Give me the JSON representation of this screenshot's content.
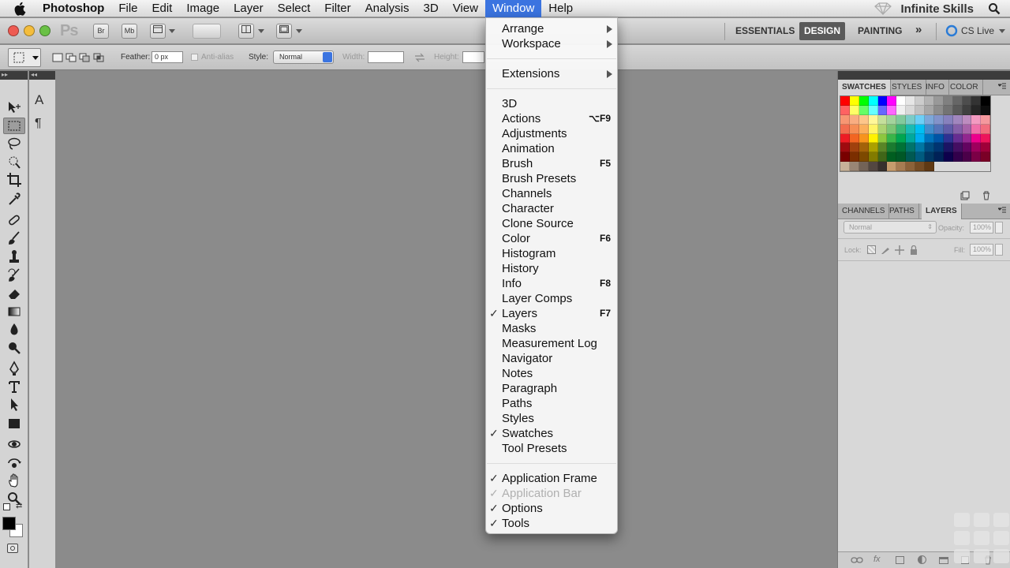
{
  "menubar": {
    "app_name": "Photoshop",
    "items": [
      "File",
      "Edit",
      "Image",
      "Layer",
      "Select",
      "Filter",
      "Analysis",
      "3D",
      "View",
      "Window",
      "Help"
    ],
    "active": "Window",
    "brand": "Infinite Skills"
  },
  "appbar": {
    "logo": "Ps",
    "bridge_btn": "Br",
    "minibridge_btn": "Mb",
    "workspaces": [
      "ESSENTIALS",
      "DESIGN",
      "PAINTING"
    ],
    "active_workspace": "DESIGN",
    "more": "»",
    "cs_live": "CS Live"
  },
  "options": {
    "feather_label": "Feather:",
    "feather_value": "0 px",
    "antialias_label": "Anti-alias",
    "style_label": "Style:",
    "style_value": "Normal",
    "width_label": "Width:",
    "height_label": "Height:"
  },
  "tools": [
    "move",
    "marquee",
    "lasso",
    "quick-select",
    "crop",
    "eyedropper",
    "healing",
    "brush",
    "stamp",
    "history-brush",
    "eraser",
    "gradient",
    "blur",
    "dodge",
    "pen",
    "type",
    "path-select",
    "shape",
    "3d-rotate",
    "3d-orbit",
    "hand",
    "zoom"
  ],
  "panels": {
    "top_tabs": [
      "SWATCHES",
      "STYLES",
      "INFO",
      "COLOR"
    ],
    "top_active": "SWATCHES",
    "bottom_tabs": [
      "CHANNELS",
      "PATHS",
      "LAYERS"
    ],
    "bottom_active": "LAYERS",
    "blend_mode": "Normal",
    "opacity_label": "Opacity:",
    "opacity_value": "100%",
    "lock_label": "Lock:",
    "fill_label": "Fill:",
    "fill_value": "100%",
    "swatches": [
      "#ff0000",
      "#ffff00",
      "#00ff00",
      "#00ffff",
      "#0000ff",
      "#ff00ff",
      "#ffffff",
      "#e6e6e6",
      "#cccccc",
      "#b3b3b3",
      "#999999",
      "#808080",
      "#666666",
      "#4d4d4d",
      "#333333",
      "#000000",
      "#ff6262",
      "#ffff66",
      "#66ff66",
      "#66ffff",
      "#6666ff",
      "#ff66ff",
      "#f0f0f0",
      "#d9d9d9",
      "#c0c0c0",
      "#a6a6a6",
      "#8c8c8c",
      "#737373",
      "#595959",
      "#404040",
      "#262626",
      "#0d0d0d",
      "#f79673",
      "#f9ad81",
      "#fdc68a",
      "#fff799",
      "#c4df9b",
      "#a3d39c",
      "#82ca9c",
      "#7accc8",
      "#6dcff6",
      "#7da7d9",
      "#8393ca",
      "#8781bd",
      "#a186be",
      "#bd8cbf",
      "#f49ac1",
      "#f5989d",
      "#f26c4f",
      "#f68e55",
      "#fbaf5c",
      "#fff467",
      "#acd373",
      "#7cc576",
      "#3bb878",
      "#1abbb4",
      "#00bff3",
      "#438ccb",
      "#5574b9",
      "#605ca8",
      "#855fa8",
      "#a763a8",
      "#f06ea9",
      "#f26d7d",
      "#ed1c24",
      "#f26522",
      "#f7941d",
      "#fff200",
      "#8dc73f",
      "#39b54a",
      "#00a651",
      "#00a99d",
      "#00aeef",
      "#0072bc",
      "#0054a6",
      "#2e3192",
      "#662d91",
      "#92278f",
      "#ec008c",
      "#ed145b",
      "#9e0b0f",
      "#a0410d",
      "#a36209",
      "#aba000",
      "#598527",
      "#1a7b30",
      "#007236",
      "#00746b",
      "#0076a3",
      "#004b80",
      "#003471",
      "#1b1464",
      "#440e62",
      "#630460",
      "#9e005d",
      "#9e0039",
      "#790000",
      "#7b2e00",
      "#7d4900",
      "#827b00",
      "#406618",
      "#005e20",
      "#005826",
      "#005952",
      "#005b7f",
      "#003663",
      "#002157",
      "#0d004c",
      "#32004b",
      "#4b0049",
      "#7b0046",
      "#7a0026",
      "#c7b299",
      "#998675",
      "#736357",
      "#534741",
      "#37302d",
      "#c69c6d",
      "#a67c52",
      "#8c6239",
      "#754c24",
      "#603913"
    ]
  },
  "window_menu": {
    "items": [
      {
        "label": "Arrange",
        "submenu": true
      },
      {
        "label": "Workspace",
        "submenu": true
      },
      {
        "sep": true
      },
      {
        "label": "Extensions",
        "submenu": true
      },
      {
        "sep": true
      },
      {
        "label": "3D"
      },
      {
        "label": "Actions",
        "shortcut": "⌥F9"
      },
      {
        "label": "Adjustments"
      },
      {
        "label": "Animation"
      },
      {
        "label": "Brush",
        "shortcut": "F5"
      },
      {
        "label": "Brush Presets"
      },
      {
        "label": "Channels"
      },
      {
        "label": "Character"
      },
      {
        "label": "Clone Source"
      },
      {
        "label": "Color",
        "shortcut": "F6"
      },
      {
        "label": "Histogram"
      },
      {
        "label": "History"
      },
      {
        "label": "Info",
        "shortcut": "F8"
      },
      {
        "label": "Layer Comps"
      },
      {
        "label": "Layers",
        "shortcut": "F7",
        "checked": true
      },
      {
        "label": "Masks"
      },
      {
        "label": "Measurement Log"
      },
      {
        "label": "Navigator"
      },
      {
        "label": "Notes"
      },
      {
        "label": "Paragraph"
      },
      {
        "label": "Paths"
      },
      {
        "label": "Styles"
      },
      {
        "label": "Swatches",
        "checked": true
      },
      {
        "label": "Tool Presets"
      },
      {
        "sep": true
      },
      {
        "label": "Application Frame",
        "checked": true
      },
      {
        "label": "Application Bar",
        "checked": true,
        "disabled": true
      },
      {
        "label": "Options",
        "checked": true
      },
      {
        "label": "Tools",
        "checked": true
      }
    ]
  }
}
